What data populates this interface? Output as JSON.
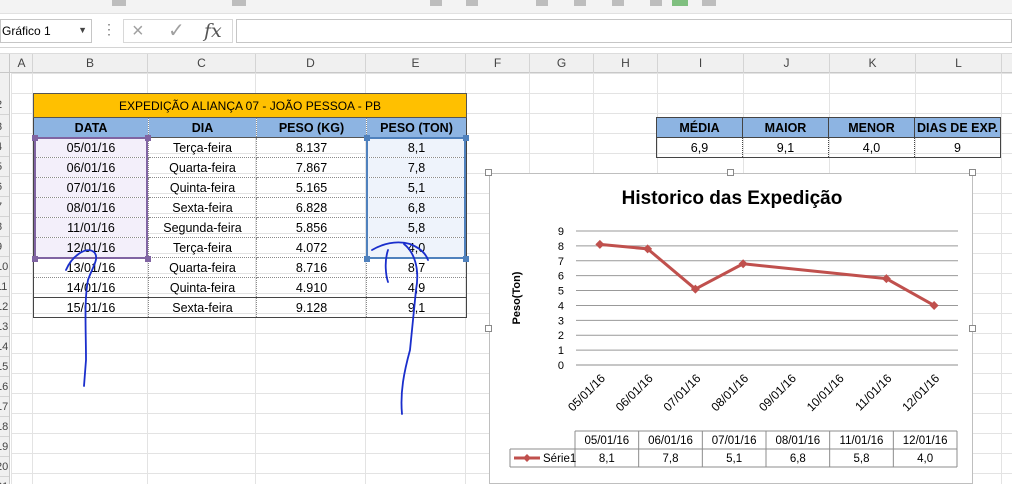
{
  "namebox": {
    "value": "Gráfico 1"
  },
  "formula_bar": {
    "cancel_icon": "×",
    "enter_icon": "✓",
    "fx_label": "fx",
    "formula": ""
  },
  "columns": [
    "A",
    "B",
    "C",
    "D",
    "E",
    "F",
    "G",
    "H",
    "I",
    "J",
    "K",
    "L"
  ],
  "rows": [
    "2",
    "3",
    "4",
    "5",
    "6",
    "7",
    "8",
    "9",
    "10",
    "11",
    "12",
    "13",
    "14",
    "15",
    "16",
    "17",
    "18",
    "19",
    "20",
    "21"
  ],
  "main_table": {
    "title": "EXPEDIÇÃO ALIANÇA 07 - JOÃO PESSOA - PB",
    "headers": [
      "DATA",
      "DIA",
      "PESO  (KG)",
      "PESO  (TON)"
    ],
    "rows": [
      [
        "05/01/16",
        "Terça-feira",
        "8.137",
        "8,1"
      ],
      [
        "06/01/16",
        "Quarta-feira",
        "7.867",
        "7,8"
      ],
      [
        "07/01/16",
        "Quinta-feira",
        "5.165",
        "5,1"
      ],
      [
        "08/01/16",
        "Sexta-feira",
        "6.828",
        "6,8"
      ],
      [
        "11/01/16",
        "Segunda-feira",
        "5.856",
        "5,8"
      ],
      [
        "12/01/16",
        "Terça-feira",
        "4.072",
        "4,0"
      ],
      [
        "13/01/16",
        "Quarta-feira",
        "8.716",
        "8,7"
      ],
      [
        "14/01/16",
        "Quinta-feira",
        "4.910",
        "4,9"
      ],
      [
        "15/01/16",
        "Sexta-feira",
        "9.128",
        "9,1"
      ]
    ]
  },
  "summary_table": {
    "headers": [
      "MÉDIA",
      "MAIOR",
      "MENOR",
      "DIAS DE EXP."
    ],
    "values": [
      "6,9",
      "9,1",
      "4,0",
      "9"
    ]
  },
  "colors": {
    "header_blue": "#8db4e2",
    "title_yellow": "#ffc000",
    "series_red": "#c0504d",
    "ink_blue": "#1a2ecc"
  },
  "chart_data": {
    "type": "line",
    "title": "Historico das Expedição",
    "ylabel": "Peso(Ton)",
    "xlabel": "",
    "ylim": [
      0,
      9
    ],
    "yticks": [
      "0",
      "1",
      "2",
      "3",
      "4",
      "5",
      "6",
      "7",
      "8",
      "9"
    ],
    "x_ticks": [
      "05/01/16",
      "06/01/16",
      "07/01/16",
      "08/01/16",
      "09/01/16",
      "10/01/16",
      "11/01/16",
      "12/01/16"
    ],
    "table_categories": [
      "05/01/16",
      "06/01/16",
      "07/01/16",
      "08/01/16",
      "11/01/16",
      "12/01/16"
    ],
    "series": [
      {
        "name": "Série1",
        "x": [
          "05/01/16",
          "06/01/16",
          "07/01/16",
          "08/01/16",
          "11/01/16",
          "12/01/16"
        ],
        "values": [
          8.1,
          7.8,
          5.1,
          6.8,
          5.8,
          4.0
        ],
        "labels": [
          "8,1",
          "7,8",
          "5,1",
          "6,8",
          "5,8",
          "4,0"
        ]
      }
    ],
    "grid": true,
    "legend": "data-table"
  }
}
